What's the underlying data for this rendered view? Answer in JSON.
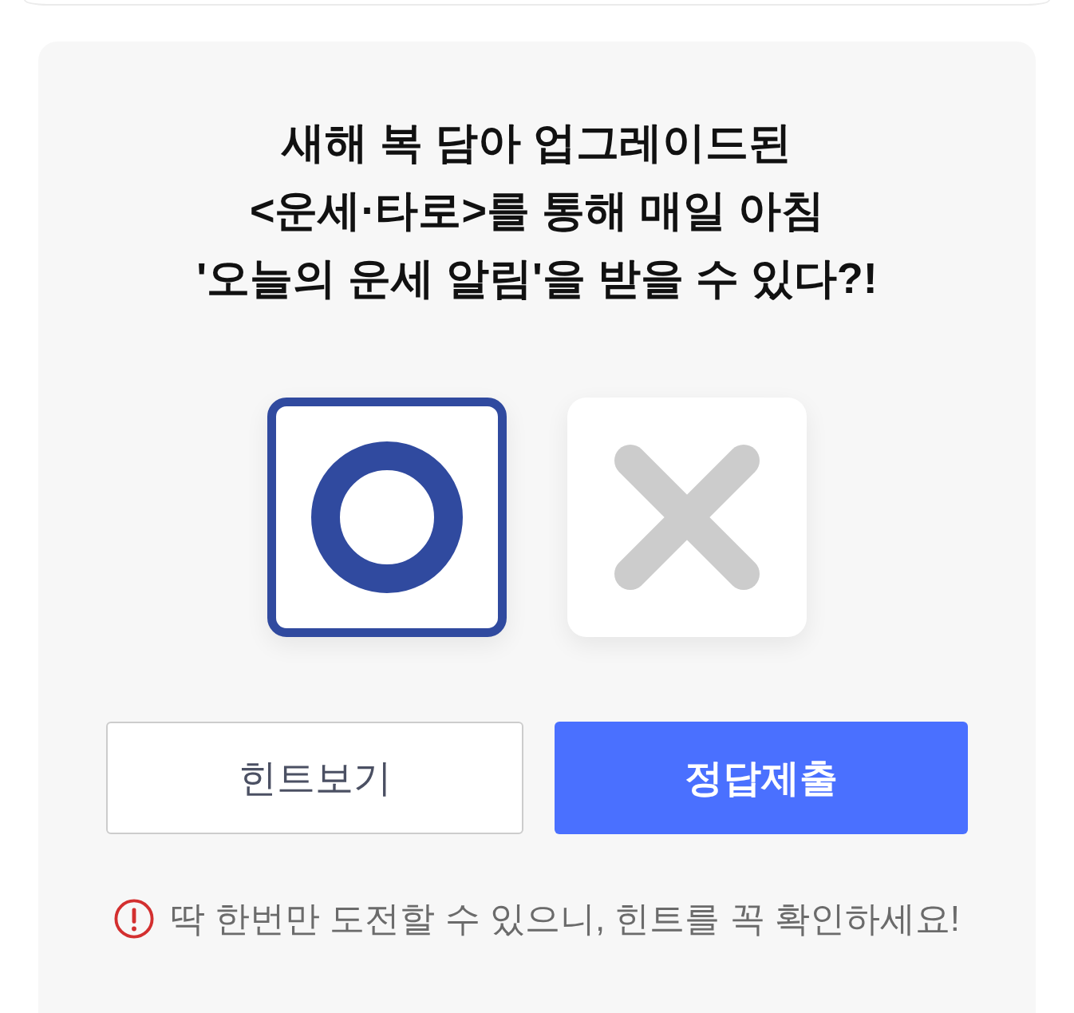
{
  "title_lines": [
    "새해 복 담아 업그레이드된",
    "<운세·타로>를 통해 매일 아침",
    "'오늘의 운세 알림'을 받을 수 있다?!"
  ],
  "choices": [
    {
      "kind": "o",
      "selected": true
    },
    {
      "kind": "x",
      "selected": false
    }
  ],
  "buttons": [
    {
      "kind": "secondary",
      "label": "힌트보기"
    },
    {
      "kind": "primary",
      "label": "정답제출"
    }
  ],
  "notice": "딱 한번만 도전할 수 있으니, 힌트를 꼭 확인하세요!"
}
